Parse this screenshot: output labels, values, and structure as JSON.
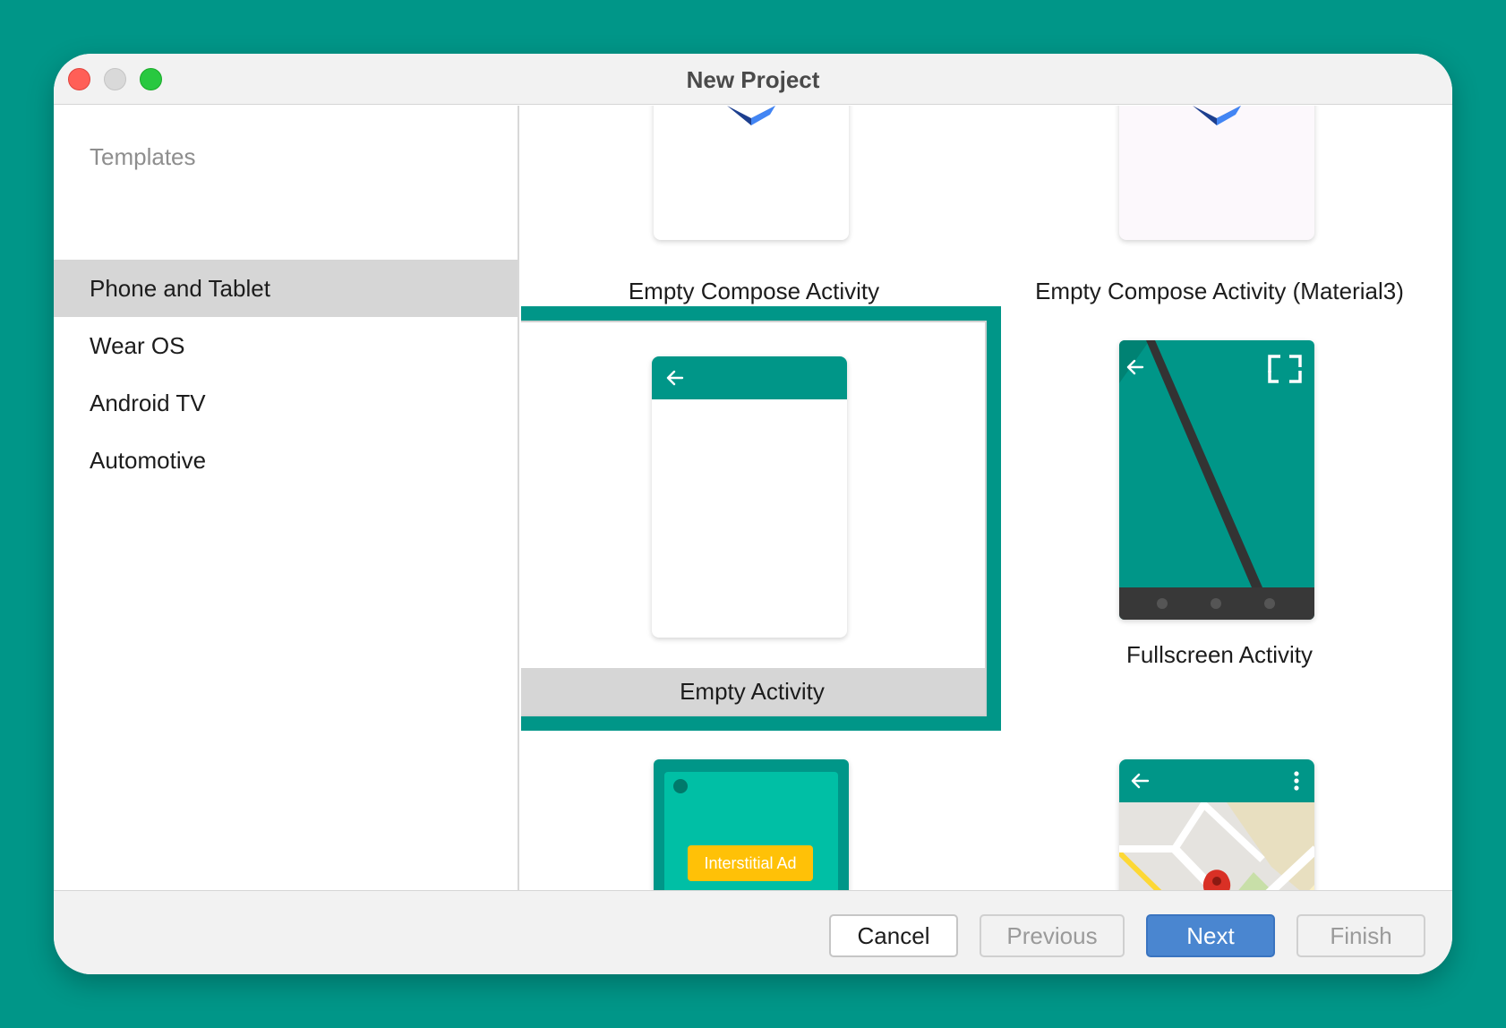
{
  "window": {
    "title": "New Project"
  },
  "sidebar": {
    "header": "Templates",
    "items": [
      {
        "label": "Phone and Tablet",
        "selected": true
      },
      {
        "label": "Wear OS",
        "selected": false
      },
      {
        "label": "Android TV",
        "selected": false
      },
      {
        "label": "Automotive",
        "selected": false
      }
    ]
  },
  "templates": [
    {
      "label": "Empty Compose Activity",
      "icon": "compose-icon"
    },
    {
      "label": "Empty Compose Activity (Material3)",
      "icon": "compose-icon"
    },
    {
      "label": "Empty Activity",
      "icon": "empty-activity-preview",
      "selected": true
    },
    {
      "label": "Fullscreen Activity",
      "icon": "fullscreen-preview"
    },
    {
      "label": "",
      "icon": "interstitial-ad-preview",
      "badge": "Interstitial Ad"
    },
    {
      "label": "",
      "icon": "maps-preview"
    }
  ],
  "footer": {
    "cancel": "Cancel",
    "previous": "Previous",
    "next": "Next",
    "finish": "Finish"
  },
  "colors": {
    "background": "#009688",
    "accent": "#009688",
    "primary_button": "#4a86d0",
    "ad_badge": "#ffc107"
  }
}
